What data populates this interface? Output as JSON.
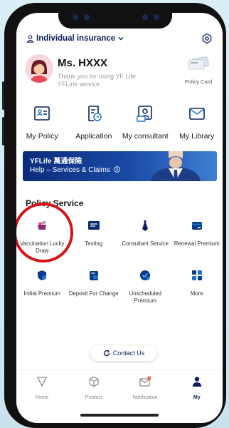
{
  "header": {
    "insurance_select": "Individual insurance"
  },
  "profile": {
    "name": "Ms. HXXX",
    "thanks": "Thank you for using YF Life YFLink service",
    "policy_card_label": "Policy Card"
  },
  "quick_menu": [
    {
      "label": "My Policy",
      "icon": "policy-doc-icon"
    },
    {
      "label": "Application",
      "icon": "application-clock-icon"
    },
    {
      "label": "My consultant",
      "icon": "consultant-icon"
    },
    {
      "label": "My Library",
      "icon": "mail-library-icon"
    }
  ],
  "banner": {
    "brand": "YFLife 萬通保險",
    "text": "Help – Services & Claims"
  },
  "policy_service": {
    "title": "Policy Service",
    "items": [
      {
        "label": "Vaccination Lucky Draw",
        "icon": "gift-basket-icon"
      },
      {
        "label": "Testing",
        "icon": "yflife-logo-icon"
      },
      {
        "label": "Consultant Service",
        "icon": "tie-icon"
      },
      {
        "label": "Renewal Premium",
        "icon": "card-icon"
      },
      {
        "label": "Initial Premium",
        "icon": "shield-icon"
      },
      {
        "label": "Deposit For Change",
        "icon": "deposit-icon"
      },
      {
        "label": "Unscheduled Premium",
        "icon": "check-shield-icon"
      },
      {
        "label": "More",
        "icon": "grid-icon"
      }
    ]
  },
  "contact_us": "Contact Us",
  "bottom_nav": [
    {
      "label": "Home",
      "icon": "triangle-home-icon"
    },
    {
      "label": "Product",
      "icon": "cube-icon"
    },
    {
      "label": "Notification",
      "icon": "envelope-icon"
    },
    {
      "label": "My",
      "icon": "person-icon"
    }
  ],
  "colors": {
    "brand_navy": "#0b1f5c",
    "accent_blue": "#1a73c8",
    "highlight_red": "#d4141a"
  }
}
